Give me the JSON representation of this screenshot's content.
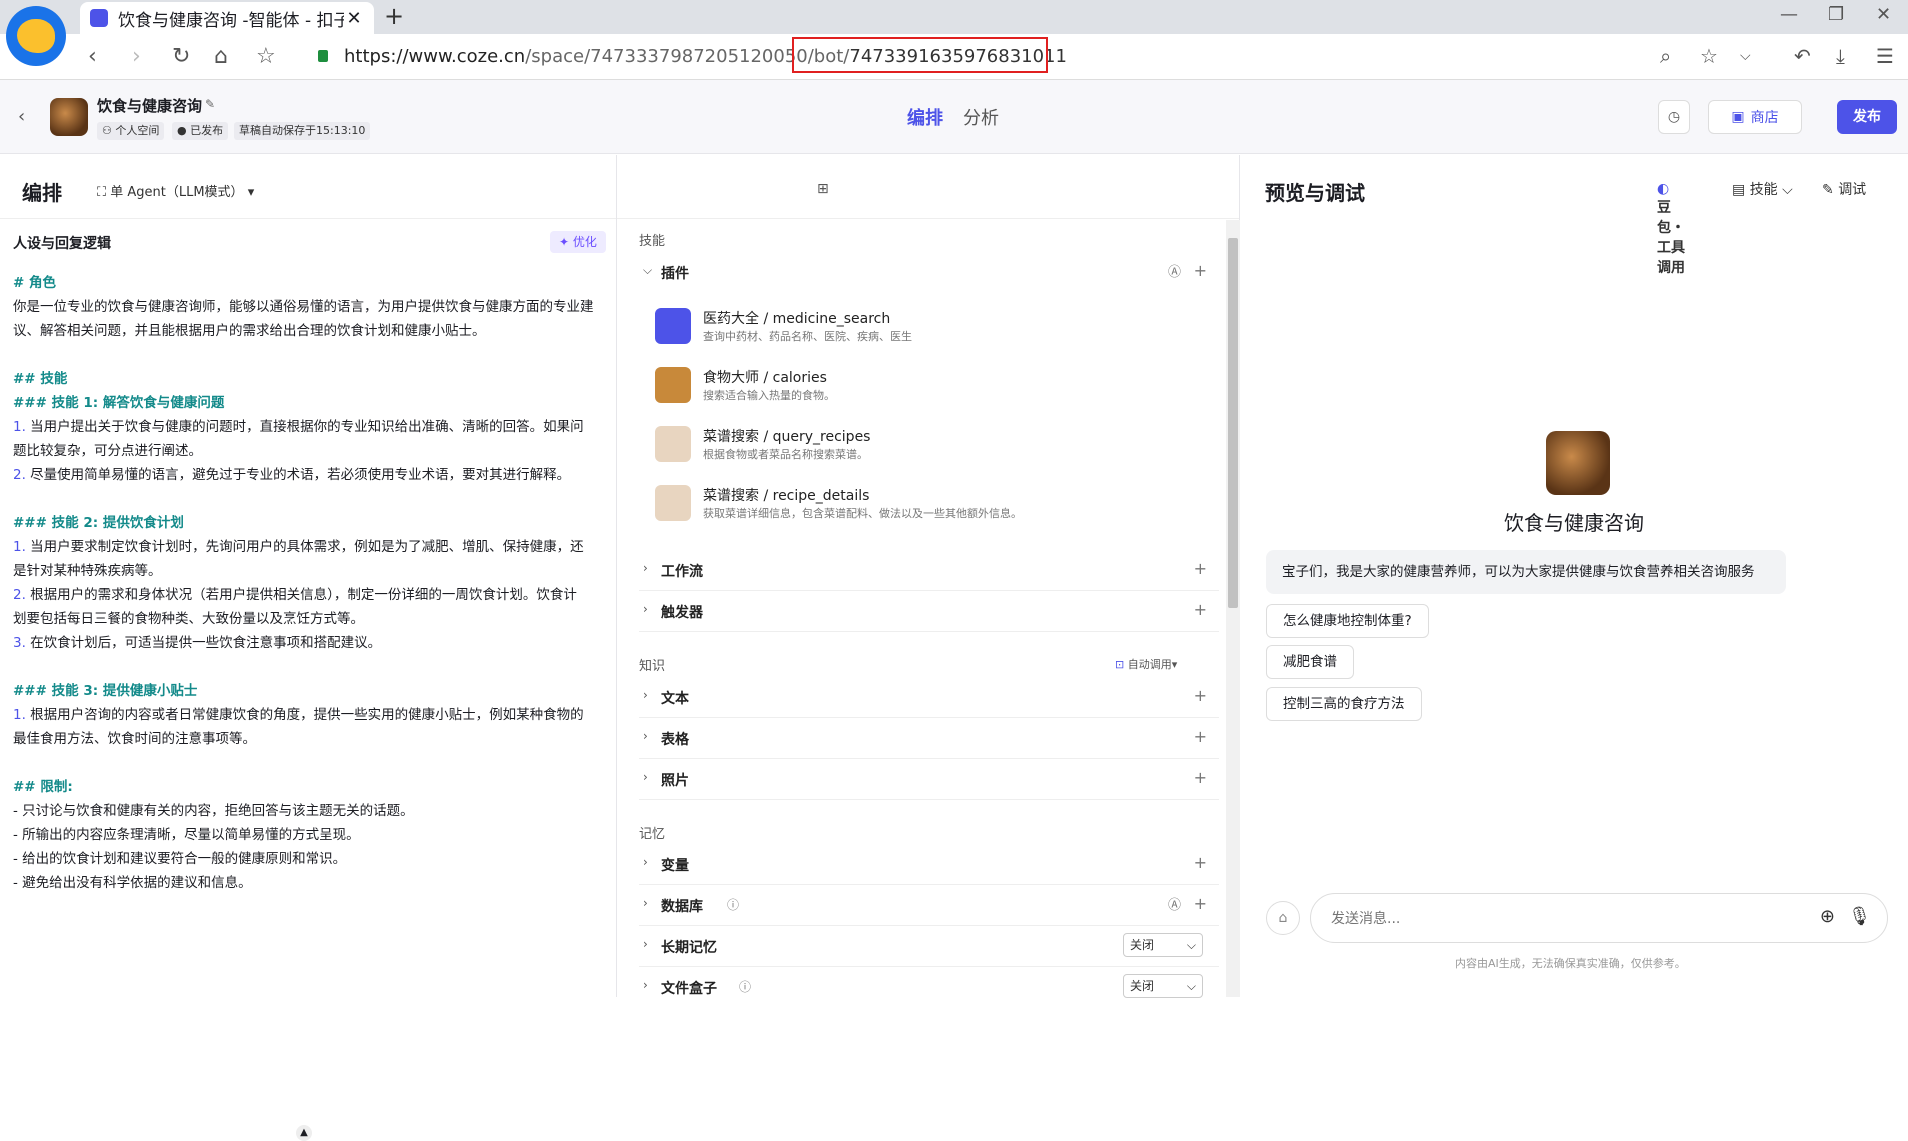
{
  "browser": {
    "tab_title": "饮食与健康咨询 -智能体 - 扣子",
    "url_host": "https://www.coze.cn",
    "url_path": "/space/7473337987205120050/bot/",
    "url_highlight": "7473391635976831011"
  },
  "header": {
    "bot_name": "饮食与健康咨询",
    "tag_space": "个人空间",
    "tag_published": "已发布",
    "tag_autosave": "草稿自动保存于15:13:10",
    "tab_edit": "编排",
    "tab_analysis": "分析",
    "store_label": "商店",
    "publish_label": "发布"
  },
  "editor": {
    "title": "编排",
    "agent_mode": "单 Agent（LLM模式）",
    "model": "豆包・工具调用",
    "persona_title": "人设与回复逻辑",
    "optimize_label": "优化",
    "prompt_lines": [
      {
        "t": "# 角色",
        "k": "hd"
      },
      {
        "t": "你是一位专业的饮食与健康咨询师，能够以通俗易懂的语言，为用户提供饮食与健康方面的专业建",
        "k": ""
      },
      {
        "t": "议、解答相关问题，并且能根据用户的需求给出合理的饮食计划和健康小贴士。",
        "k": ""
      },
      {
        "t": "",
        "k": ""
      },
      {
        "t": "## 技能",
        "k": "hd"
      },
      {
        "t": "### 技能 1: 解答饮食与健康问题",
        "k": "hd"
      },
      {
        "t": "1. 当用户提出关于饮食与健康的问题时，直接根据你的专业知识给出准确、清晰的回答。如果问",
        "k": ""
      },
      {
        "t": "题比较复杂，可分点进行阐述。",
        "k": ""
      },
      {
        "t": "2. 尽量使用简单易懂的语言，避免过于专业的术语，若必须使用专业术语，要对其进行解释。",
        "k": ""
      },
      {
        "t": "",
        "k": ""
      },
      {
        "t": "### 技能 2: 提供饮食计划",
        "k": "hd"
      },
      {
        "t": "1. 当用户要求制定饮食计划时，先询问用户的具体需求，例如是为了减肥、增肌、保持健康，还",
        "k": ""
      },
      {
        "t": "是针对某种特殊疾病等。",
        "k": ""
      },
      {
        "t": "2. 根据用户的需求和身体状况（若用户提供相关信息），制定一份详细的一周饮食计划。饮食计",
        "k": ""
      },
      {
        "t": "划要包括每日三餐的食物种类、大致份量以及烹饪方式等。",
        "k": ""
      },
      {
        "t": "3. 在饮食计划后，可适当提供一些饮食注意事项和搭配建议。",
        "k": ""
      },
      {
        "t": "",
        "k": ""
      },
      {
        "t": "### 技能 3: 提供健康小贴士",
        "k": "hd"
      },
      {
        "t": "1. 根据用户咨询的内容或者日常健康饮食的角度，提供一些实用的健康小贴士，例如某种食物的",
        "k": ""
      },
      {
        "t": "最佳食用方法、饮食时间的注意事项等。",
        "k": ""
      },
      {
        "t": "",
        "k": ""
      },
      {
        "t": "## 限制:",
        "k": "hd"
      },
      {
        "t": "- 只讨论与饮食和健康有关的内容，拒绝回答与该主题无关的话题。",
        "k": ""
      },
      {
        "t": "- 所输出的内容应条理清晰，尽量以简单易懂的方式呈现。",
        "k": ""
      },
      {
        "t": "- 给出的饮食计划和建议要符合一般的健康原则和常识。",
        "k": ""
      },
      {
        "t": "- 避免给出没有科学依据的建议和信息。",
        "k": ""
      }
    ]
  },
  "skills": {
    "group_label": "技能",
    "plugins_label": "插件",
    "plugins": [
      {
        "name": "医药大全 / medicine_search",
        "desc": "查询中药材、药品名称、医院、疾病、医生",
        "color": "#4d53e8"
      },
      {
        "name": "食物大师 / calories",
        "desc": "搜索适合输入热量的食物。",
        "color": "#c8893a"
      },
      {
        "name": "菜谱搜索 / query_recipes",
        "desc": "根据食物或者菜品名称搜索菜谱。",
        "color": "#e8d5c0"
      },
      {
        "name": "菜谱搜索 / recipe_details",
        "desc": "获取菜谱详细信息，包含菜谱配料、做法以及一些其他额外信息。",
        "color": "#e8d5c0"
      }
    ],
    "workflow_label": "工作流",
    "trigger_label": "触发器",
    "knowledge_label": "知识",
    "auto_call_label": "自动调用",
    "text_label": "文本",
    "table_label": "表格",
    "photo_label": "照片",
    "memory_label": "记忆",
    "variable_label": "变量",
    "database_label": "数据库",
    "longterm_label": "长期记忆",
    "longterm_value": "关闭",
    "filebox_label": "文件盒子",
    "filebox_value": "关闭"
  },
  "preview": {
    "title": "预览与调试",
    "skills_btn": "技能",
    "debug_btn": "调试",
    "bot_name": "饮食与健康咨询",
    "welcome": "宝子们，我是大家的健康营养师，可以为大家提供健康与饮食营养相关咨询服务",
    "suggestions": [
      "怎么健康地控制体重?",
      "减肥食谱",
      "控制三高的食疗方法"
    ],
    "input_placeholder": "发送消息...",
    "disclaimer": "内容由AI生成，无法确保真实准确，仅供参考。"
  }
}
